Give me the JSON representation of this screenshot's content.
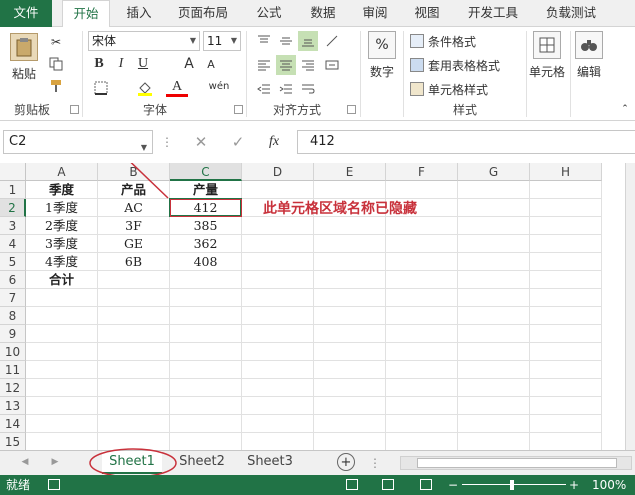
{
  "ribbon": {
    "tabs": [
      "文件",
      "开始",
      "插入",
      "页面布局",
      "公式",
      "数据",
      "审阅",
      "视图",
      "开发工具",
      "负载测试"
    ],
    "clipboard": {
      "paste": "粘贴",
      "label": "剪贴板"
    },
    "font": {
      "name": "宋体",
      "size": "11",
      "label": "字体",
      "bold": "B",
      "italic": "I",
      "underline": "U",
      "grow": "A",
      "shrink": "A",
      "wen": "wén"
    },
    "alignment": {
      "label": "对齐方式"
    },
    "number": {
      "label": "数字",
      "percent": "%"
    },
    "styles": {
      "label": "样式",
      "conditional": "条件格式",
      "table": "套用表格格式",
      "cell_styles": "单元格样式"
    },
    "cells": {
      "label": "单元格"
    },
    "editing": {
      "label": "编辑"
    }
  },
  "formula_bar": {
    "name_box": "C2",
    "fx": "fx",
    "value": "412"
  },
  "grid": {
    "columns": [
      "A",
      "B",
      "C",
      "D",
      "E",
      "F",
      "G",
      "H"
    ],
    "rows": [
      "1",
      "2",
      "3",
      "4",
      "5",
      "6",
      "7",
      "8",
      "9",
      "10",
      "11",
      "12",
      "13",
      "14",
      "15"
    ],
    "cells": [
      [
        "季度",
        "产品",
        "产量"
      ],
      [
        "1季度",
        "AC",
        "412"
      ],
      [
        "2季度",
        "3F",
        "385"
      ],
      [
        "3季度",
        "GE",
        "362"
      ],
      [
        "4季度",
        "6B",
        "408"
      ],
      [
        "合计",
        "",
        ""
      ]
    ]
  },
  "annotation": {
    "text": "此单元格区域名称已隐藏",
    "color": "#c8313b"
  },
  "sheets": [
    "Sheet1",
    "Sheet2",
    "Sheet3"
  ],
  "status": {
    "ready": "就绪",
    "zoom": "100%"
  },
  "colors": {
    "excel_green": "#217346",
    "annotation_red": "#c8313b"
  }
}
